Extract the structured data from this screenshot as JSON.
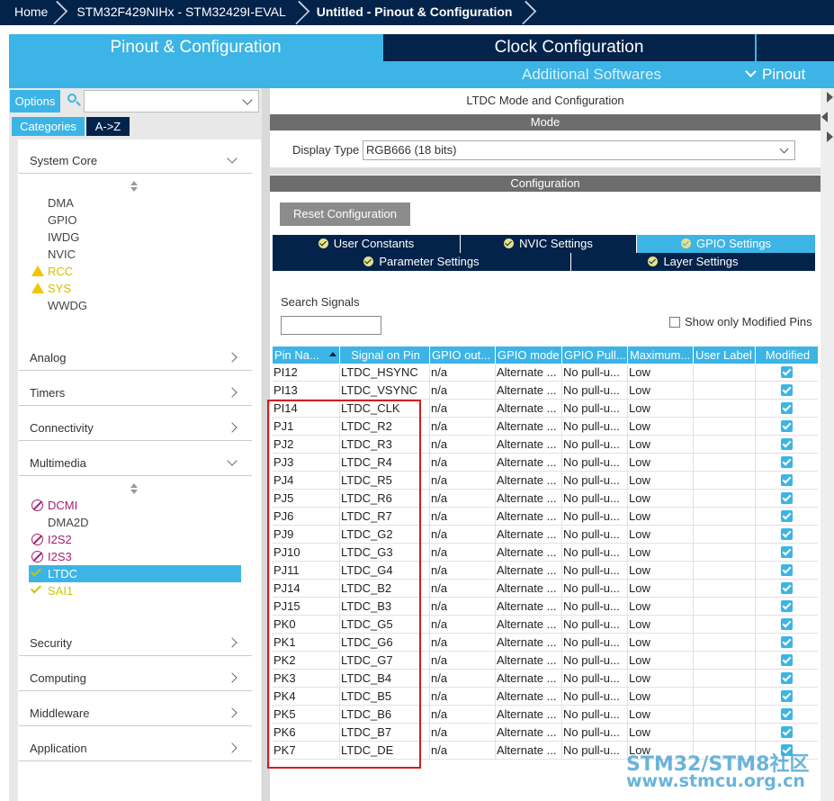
{
  "breadcrumb": [
    "Home",
    "STM32F429NIHx  -  STM32429I-EVAL",
    "Untitled - Pinout & Configuration"
  ],
  "tabs": {
    "pinout": "Pinout & Configuration",
    "clock": "Clock Configuration",
    "additional": "Additional Softwares",
    "pinout_menu": "Pinout"
  },
  "left": {
    "options": "Options",
    "search_value": "",
    "categories_tab": "Categories",
    "az_tab": "A->Z",
    "categories": {
      "system_core": "System Core",
      "analog": "Analog",
      "timers": "Timers",
      "connectivity": "Connectivity",
      "multimedia": "Multimedia",
      "security": "Security",
      "computing": "Computing",
      "middleware": "Middleware",
      "application": "Application"
    },
    "system_core_items": [
      "DMA",
      "GPIO",
      "IWDG",
      "NVIC",
      "RCC",
      "SYS",
      "WWDG"
    ],
    "multimedia_items": [
      "DCMI",
      "DMA2D",
      "I2S2",
      "I2S3",
      "LTDC",
      "SAI1"
    ]
  },
  "right": {
    "title": "LTDC Mode and Configuration",
    "mode_bar": "Mode",
    "display_type_label": "Display Type",
    "display_type_value": "RGB666 (18 bits)",
    "config_bar": "Configuration",
    "reset_button": "Reset Configuration",
    "config_tabs": {
      "user_constants": "User Constants",
      "nvic": "NVIC Settings",
      "gpio": "GPIO Settings",
      "parameter": "Parameter Settings",
      "layer": "Layer Settings"
    },
    "search_signals_label": "Search Signals",
    "search_signals_value": "",
    "show_modified_label": "Show only Modified Pins"
  },
  "table": {
    "headers": [
      "Pin Na...",
      "Signal on Pin",
      "GPIO out...",
      "GPIO mode",
      "GPIO Pull...",
      "Maximum...",
      "User Label",
      "Modified"
    ],
    "rows": [
      [
        "PI12",
        "LTDC_HSYNC",
        "n/a",
        "Alternate ...",
        "No pull-u...",
        "Low",
        ""
      ],
      [
        "PI13",
        "LTDC_VSYNC",
        "n/a",
        "Alternate ...",
        "No pull-u...",
        "Low",
        ""
      ],
      [
        "PI14",
        "LTDC_CLK",
        "n/a",
        "Alternate ...",
        "No pull-u...",
        "Low",
        ""
      ],
      [
        "PJ1",
        "LTDC_R2",
        "n/a",
        "Alternate ...",
        "No pull-u...",
        "Low",
        ""
      ],
      [
        "PJ2",
        "LTDC_R3",
        "n/a",
        "Alternate ...",
        "No pull-u...",
        "Low",
        ""
      ],
      [
        "PJ3",
        "LTDC_R4",
        "n/a",
        "Alternate ...",
        "No pull-u...",
        "Low",
        ""
      ],
      [
        "PJ4",
        "LTDC_R5",
        "n/a",
        "Alternate ...",
        "No pull-u...",
        "Low",
        ""
      ],
      [
        "PJ5",
        "LTDC_R6",
        "n/a",
        "Alternate ...",
        "No pull-u...",
        "Low",
        ""
      ],
      [
        "PJ6",
        "LTDC_R7",
        "n/a",
        "Alternate ...",
        "No pull-u...",
        "Low",
        ""
      ],
      [
        "PJ9",
        "LTDC_G2",
        "n/a",
        "Alternate ...",
        "No pull-u...",
        "Low",
        ""
      ],
      [
        "PJ10",
        "LTDC_G3",
        "n/a",
        "Alternate ...",
        "No pull-u...",
        "Low",
        ""
      ],
      [
        "PJ11",
        "LTDC_G4",
        "n/a",
        "Alternate ...",
        "No pull-u...",
        "Low",
        ""
      ],
      [
        "PJ14",
        "LTDC_B2",
        "n/a",
        "Alternate ...",
        "No pull-u...",
        "Low",
        ""
      ],
      [
        "PJ15",
        "LTDC_B3",
        "n/a",
        "Alternate ...",
        "No pull-u...",
        "Low",
        ""
      ],
      [
        "PK0",
        "LTDC_G5",
        "n/a",
        "Alternate ...",
        "No pull-u...",
        "Low",
        ""
      ],
      [
        "PK1",
        "LTDC_G6",
        "n/a",
        "Alternate ...",
        "No pull-u...",
        "Low",
        ""
      ],
      [
        "PK2",
        "LTDC_G7",
        "n/a",
        "Alternate ...",
        "No pull-u...",
        "Low",
        ""
      ],
      [
        "PK3",
        "LTDC_B4",
        "n/a",
        "Alternate ...",
        "No pull-u...",
        "Low",
        ""
      ],
      [
        "PK4",
        "LTDC_B5",
        "n/a",
        "Alternate ...",
        "No pull-u...",
        "Low",
        ""
      ],
      [
        "PK5",
        "LTDC_B6",
        "n/a",
        "Alternate ...",
        "No pull-u...",
        "Low",
        ""
      ],
      [
        "PK6",
        "LTDC_B7",
        "n/a",
        "Alternate ...",
        "No pull-u...",
        "Low",
        ""
      ],
      [
        "PK7",
        "LTDC_DE",
        "n/a",
        "Alternate ...",
        "No pull-u...",
        "Low",
        ""
      ]
    ]
  },
  "watermark": {
    "line1": "STM32/STM8社区",
    "line2": "www.stmcu.org.cn"
  },
  "colors": {
    "accent": "#3cb4e6",
    "navy": "#03234b",
    "highlight": "#d21f1f"
  }
}
